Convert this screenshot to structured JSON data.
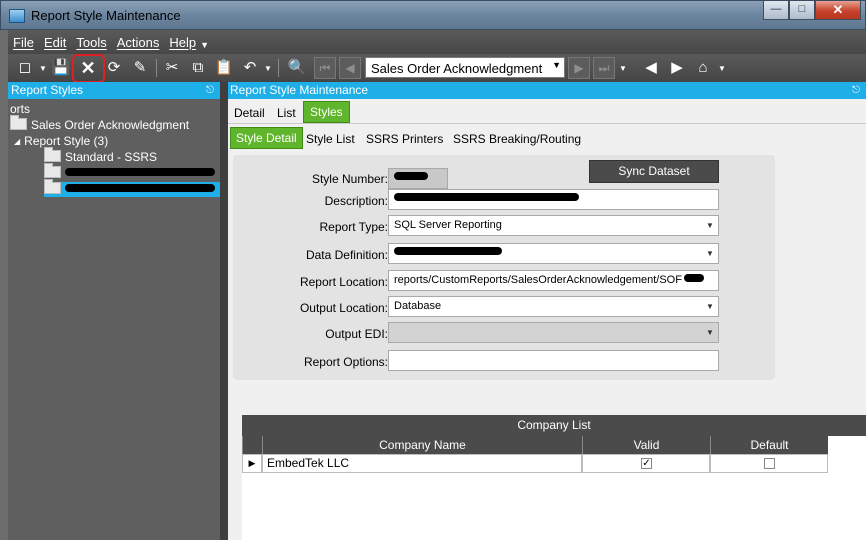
{
  "window": {
    "title": "Report Style Maintenance"
  },
  "menu": {
    "items": [
      "File",
      "Edit",
      "Tools",
      "Actions",
      "Help"
    ]
  },
  "toolbar": {
    "report_combo_value": "Sales Order Acknowledgment"
  },
  "left": {
    "header": "Report Styles",
    "root_fragment": "orts",
    "node1": "Sales Order Acknowledgment",
    "node2": "Report Style (3)",
    "node3": "Standard - SSRS"
  },
  "right": {
    "header": "Report Style Maintenance",
    "tabs": [
      "Detail",
      "List",
      "Styles"
    ],
    "subtabs": [
      "Style Detail",
      "Style List",
      "SSRS Printers",
      "SSRS Breaking/Routing"
    ],
    "form": {
      "style_number_label": "Style Number:",
      "sync_button": "Sync Dataset",
      "description_label": "Description:",
      "report_type_label": "Report Type:",
      "report_type_value": "SQL Server Reporting",
      "data_definition_label": "Data Definition:",
      "report_location_label": "Report Location:",
      "report_location_value": "reports/CustomReports/SalesOrderAcknowledgement/SOF",
      "output_location_label": "Output Location:",
      "output_location_value": "Database",
      "output_edi_label": "Output EDI:",
      "report_options_label": "Report Options:"
    },
    "company_list": {
      "title": "Company List",
      "columns": [
        "Company Name",
        "Valid",
        "Default"
      ],
      "rows": [
        {
          "name": "EmbedTek LLC",
          "valid": true,
          "default": false
        }
      ]
    }
  }
}
